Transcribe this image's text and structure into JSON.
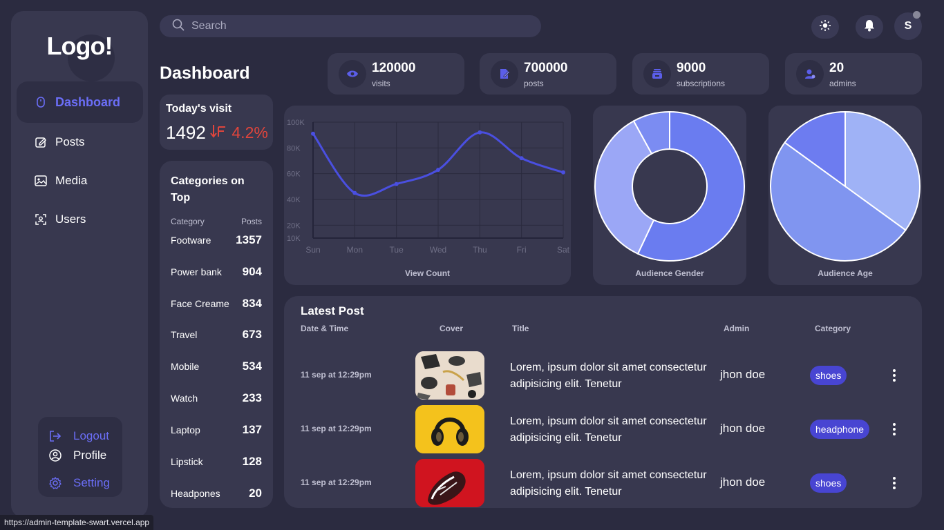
{
  "logo": "Logo!",
  "nav": [
    {
      "label": "Dashboard",
      "icon": "mouse-icon",
      "active": true
    },
    {
      "label": "Posts",
      "icon": "edit-icon"
    },
    {
      "label": "Media",
      "icon": "image-icon"
    },
    {
      "label": "Users",
      "icon": "users-icon"
    }
  ],
  "account": {
    "logout": "Logout",
    "profile": "Profile",
    "setting": "Setting"
  },
  "search": {
    "placeholder": "Search"
  },
  "header": {
    "avatar": "S"
  },
  "page_title": "Dashboard",
  "stats": [
    {
      "value": "120000",
      "label": "visits",
      "icon": "eye-icon"
    },
    {
      "value": "700000",
      "label": "posts",
      "icon": "post-icon"
    },
    {
      "value": "9000",
      "label": "subscriptions",
      "icon": "subscription-icon"
    },
    {
      "value": "20",
      "label": "admins",
      "icon": "admin-icon"
    }
  ],
  "today_visit": {
    "title": "Today's visit",
    "value": "1492",
    "delta": "4.2%",
    "delta_color": "#e0453c"
  },
  "categories": {
    "title": "Categories on Top",
    "col_category": "Category",
    "col_posts": "Posts",
    "rows": [
      {
        "name": "Footware",
        "count": "1357"
      },
      {
        "name": "Power bank",
        "count": "904"
      },
      {
        "name": "Face Creame",
        "count": "834"
      },
      {
        "name": "Travel",
        "count": "673"
      },
      {
        "name": "Mobile",
        "count": "534"
      },
      {
        "name": "Watch",
        "count": "233"
      },
      {
        "name": "Laptop",
        "count": "137"
      },
      {
        "name": "Lipstick",
        "count": "128"
      },
      {
        "name": "Headpones",
        "count": "20"
      }
    ]
  },
  "chart_data": [
    {
      "type": "line",
      "xlabel": "View Count",
      "categories": [
        "Sun",
        "Mon",
        "Tue",
        "Wed",
        "Thu",
        "Fri",
        "Sat"
      ],
      "values": [
        91000,
        45000,
        52000,
        63000,
        92000,
        72000,
        61000
      ],
      "y_ticks": [
        "100K",
        "80K",
        "60K",
        "40K",
        "20K",
        "10K"
      ],
      "ylim": [
        10000,
        100000
      ],
      "grid": true,
      "color": "#4a4fe0"
    },
    {
      "type": "pie",
      "style": "donut",
      "xlabel": "Audience Gender",
      "values": [
        57,
        35,
        8
      ],
      "colors": [
        "#6a7cf0",
        "#9ba7f6",
        "#7b8cf2"
      ]
    },
    {
      "type": "pie",
      "xlabel": "Audience Age",
      "values": [
        35,
        50,
        15
      ],
      "colors": [
        "#9fb2f6",
        "#8095f0",
        "#6d7cf0"
      ]
    }
  ],
  "latest_post": {
    "title": "Latest Post",
    "columns": [
      "Date & Time",
      "Cover",
      "Title",
      "Admin",
      "Category"
    ],
    "rows": [
      {
        "date": "11 sep at 12:29pm",
        "title": "Lorem, ipsum dolor sit amet consectetur adipisicing elit. Tenetur",
        "admin": "jhon doe",
        "category": "shoes",
        "cover": "flatlay"
      },
      {
        "date": "11 sep at 12:29pm",
        "title": "Lorem, ipsum dolor sit amet consectetur adipisicing elit. Tenetur",
        "admin": "jhon doe",
        "category": "headphone",
        "cover": "headphone"
      },
      {
        "date": "11 sep at 12:29pm",
        "title": "Lorem, ipsum dolor sit amet consectetur adipisicing elit. Tenetur",
        "admin": "jhon doe",
        "category": "shoes",
        "cover": "sneaker"
      }
    ]
  },
  "status_url": "https://admin-template-swart.vercel.app"
}
